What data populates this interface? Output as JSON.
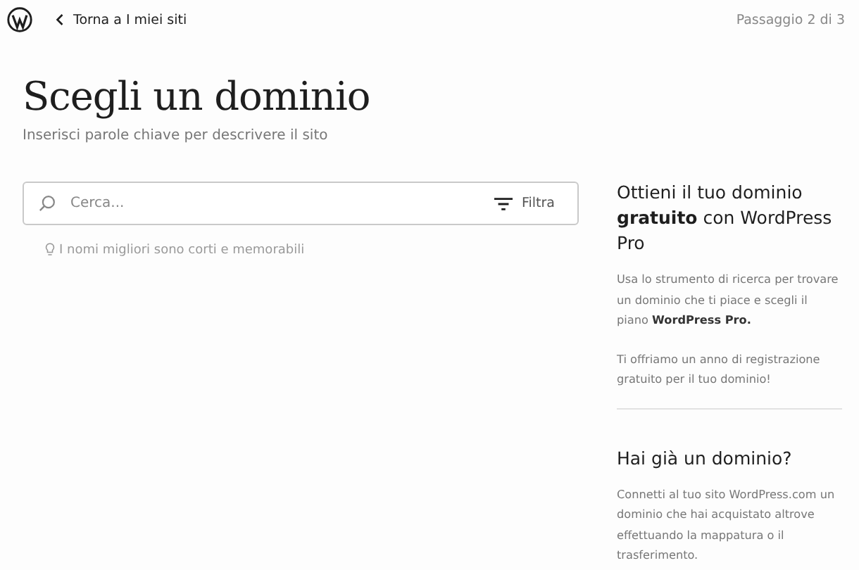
{
  "header": {
    "back_link": "Torna a I miei siti",
    "step": "Passaggio 2 di 3"
  },
  "title": "Scegli un dominio",
  "subtitle": "Inserisci parole chiave per descrivere il sito",
  "search": {
    "placeholder": "Cerca...",
    "filter_button": "Filtra"
  },
  "hint": "I nomi migliori sono corti e memorabili",
  "sidebar": [
    {
      "heading": "Ottieni il tuo dominio **gratuito** con WordPress Pro",
      "paragraphs": [
        "Usa lo strumento di ricerca per trovare un dominio che ti piace e scegli il piano **WordPress Pro.**",
        "Ti offriamo un anno di registrazione gratuito per il tuo dominio!"
      ]
    },
    {
      "heading": "Hai già un dominio?",
      "paragraphs": [
        "Connetti al tuo sito WordPress.com un dominio che hai acquistato altrove effettuando la mappatura o il trasferimento."
      ]
    }
  ]
}
